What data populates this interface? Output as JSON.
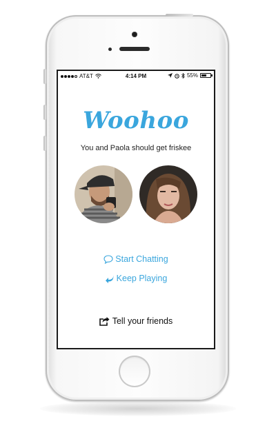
{
  "status_bar": {
    "carrier": "AT&T",
    "time": "4:14 PM",
    "battery_percent": "55%",
    "battery_level": 0.55,
    "icons": [
      "signal-dots-icon",
      "wifi-icon",
      "location-arrow-icon",
      "alarm-icon",
      "bluetooth-icon",
      "battery-icon"
    ]
  },
  "match": {
    "title": "Woohoo",
    "message": "You and Paola should get friskee"
  },
  "actions": {
    "start_chatting": "Start Chatting",
    "keep_playing": "Keep Playing",
    "tell_friends": "Tell your friends"
  },
  "colors": {
    "accent": "#3aa6dd",
    "text": "#222222"
  }
}
